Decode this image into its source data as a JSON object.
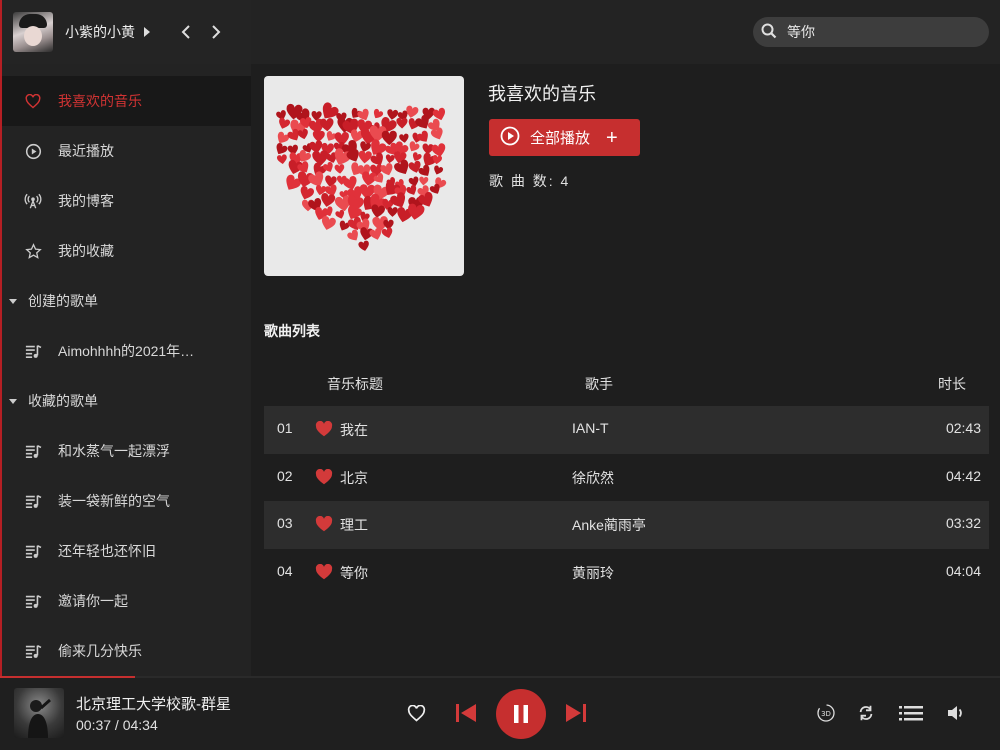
{
  "user": {
    "name": "小紫的小黄"
  },
  "search": {
    "value": "等你"
  },
  "sidebar": {
    "items": [
      {
        "label": "我喜欢的音乐",
        "icon": "heart-outline-icon",
        "active": true
      },
      {
        "label": "最近播放",
        "icon": "play-circle-icon"
      },
      {
        "label": "我的博客",
        "icon": "podcast-icon"
      },
      {
        "label": "我的收藏",
        "icon": "star-icon"
      }
    ],
    "created_header": "创建的歌单",
    "created": [
      {
        "label": "Aimohhhh的2021年…",
        "icon": "playlist-icon"
      }
    ],
    "collected_header": "收藏的歌单",
    "collected": [
      {
        "label": "和水蒸气一起漂浮",
        "icon": "playlist-icon"
      },
      {
        "label": "装一袋新鲜的空气",
        "icon": "playlist-icon"
      },
      {
        "label": "还年轻也还怀旧",
        "icon": "playlist-icon"
      },
      {
        "label": "邀请你一起",
        "icon": "playlist-icon"
      },
      {
        "label": "偷来几分快乐",
        "icon": "playlist-icon"
      }
    ]
  },
  "playlist": {
    "title": "我喜欢的音乐",
    "play_all_label": "全部播放",
    "play_all_plus": "+",
    "song_count_label": "歌 曲 数: 4",
    "list_title": "歌曲列表"
  },
  "table": {
    "headers": {
      "title": "音乐标题",
      "artist": "歌手",
      "duration": "时长"
    },
    "rows": [
      {
        "index": "01",
        "title": "我在",
        "artist": "IAN-T",
        "duration": "02:43"
      },
      {
        "index": "02",
        "title": "北京",
        "artist": "徐欣然",
        "duration": "04:42"
      },
      {
        "index": "03",
        "title": "理工",
        "artist": "Anke蔺雨亭",
        "duration": "03:32"
      },
      {
        "index": "04",
        "title": "等你",
        "artist": "黄丽玲",
        "duration": "04:04"
      }
    ]
  },
  "player": {
    "title": "北京理工大学校歌-群星",
    "time": "00:37 / 04:34",
    "progress": 0.135
  },
  "colors": {
    "accent": "#c62f2f",
    "sidebar_bg": "#232323",
    "main_bg": "#1e1e1e"
  }
}
